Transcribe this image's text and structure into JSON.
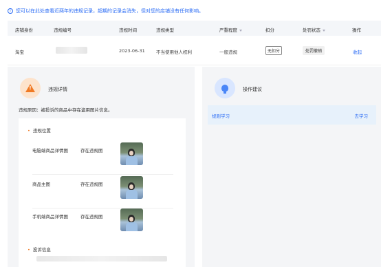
{
  "notice": {
    "icon": "info-icon",
    "text": "您可以在此处查看近两年的违规记录，超期的记录会消失，但对您的店铺没有任何影响。"
  },
  "table": {
    "headers": [
      "店铺身份",
      "违规编号",
      "违规时间",
      "违规类型",
      "严重程度",
      "扣分",
      "处罚状态",
      "操作"
    ],
    "rows": [
      {
        "shop": "淘宝",
        "id": "",
        "time": "2023-06-31",
        "type": "不当使用他人权利",
        "severity": "一般违规",
        "points": "无扣分",
        "status": "处罚撤销",
        "action": "收起"
      }
    ]
  },
  "left_panel": {
    "icon": "warning-icon",
    "title": "违规详情",
    "reason": "违规原因：被投诉的商品中存在盗用图片信息。",
    "location_title": "违规位置",
    "locations": [
      {
        "name": "电脑端商品详情图",
        "status": "存在违规图"
      },
      {
        "name": "商品主图",
        "status": "存在违规图"
      },
      {
        "name": "手机端商品详情图",
        "status": "存在违规图"
      }
    ],
    "complaint_title": "投诉信息"
  },
  "right_panel": {
    "icon": "lightbulb-icon",
    "title": "操作建议",
    "items": [
      {
        "label": "规则学习",
        "action": "去学习"
      }
    ]
  },
  "colors": {
    "accent": "#2b6cf5",
    "warning": "#f07a25"
  }
}
